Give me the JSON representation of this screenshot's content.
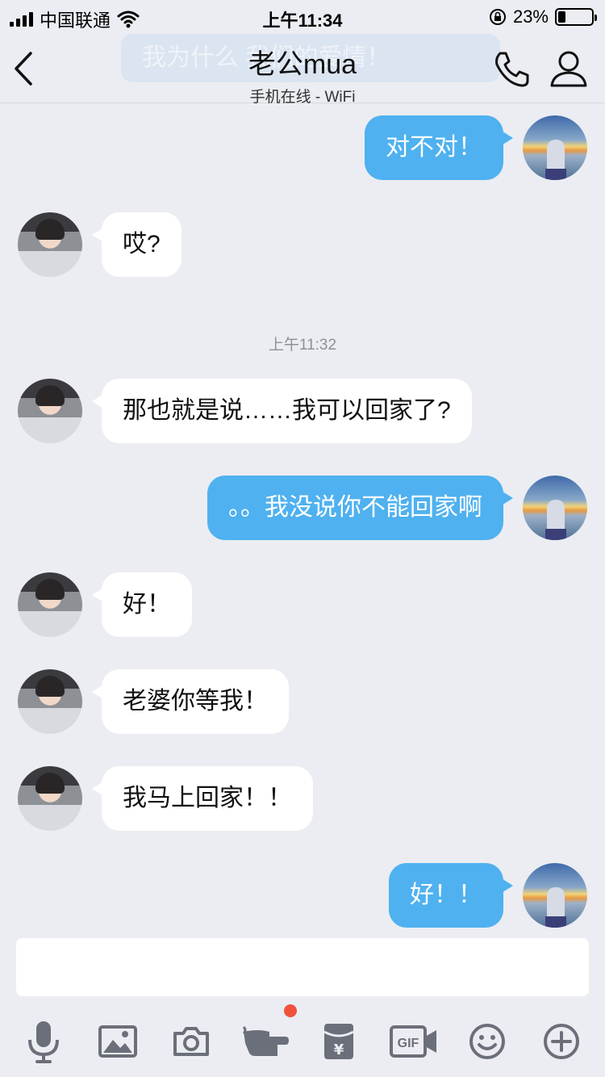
{
  "status_bar": {
    "carrier": "中国联通",
    "time": "上午11:34",
    "battery_percent": "23%",
    "battery_level": 0.23,
    "icons": [
      "signal-icon",
      "wifi-icon",
      "orientation-lock-icon",
      "battery-icon"
    ]
  },
  "header": {
    "ghost_banner": "我为什么 我们的爱情！",
    "title": "老公mua",
    "subtitle": "手机在线 - WiFi",
    "icons": [
      "back-icon",
      "phone-icon",
      "profile-icon"
    ]
  },
  "messages": [
    {
      "sender": "me",
      "text": "对不对！"
    },
    {
      "sender": "peer",
      "text": "哎?"
    },
    {
      "type": "timestamp",
      "text": "上午11:32"
    },
    {
      "sender": "peer",
      "text": "那也就是说……我可以回家了?"
    },
    {
      "sender": "me",
      "text": "。。我没说你不能回家啊"
    },
    {
      "sender": "peer",
      "text": "好！"
    },
    {
      "sender": "peer",
      "text": "老婆你等我！"
    },
    {
      "sender": "peer",
      "text": "我马上回家！！"
    },
    {
      "sender": "me",
      "text": "好！！"
    }
  ],
  "input": {
    "value": "",
    "placeholder": ""
  },
  "toolbar": {
    "items": [
      "microphone-icon",
      "image-icon",
      "camera-icon",
      "poke-icon",
      "red-packet-icon",
      "gif-icon",
      "emoji-icon",
      "plus-icon"
    ],
    "badge_on": "poke-icon",
    "gif_label": "GIF"
  },
  "colors": {
    "background": "#ebedf2",
    "my_bubble": "#4fb1ef",
    "peer_bubble": "#ffffff",
    "icon_gray": "#6b6f7a",
    "badge_red": "#f0533d"
  }
}
